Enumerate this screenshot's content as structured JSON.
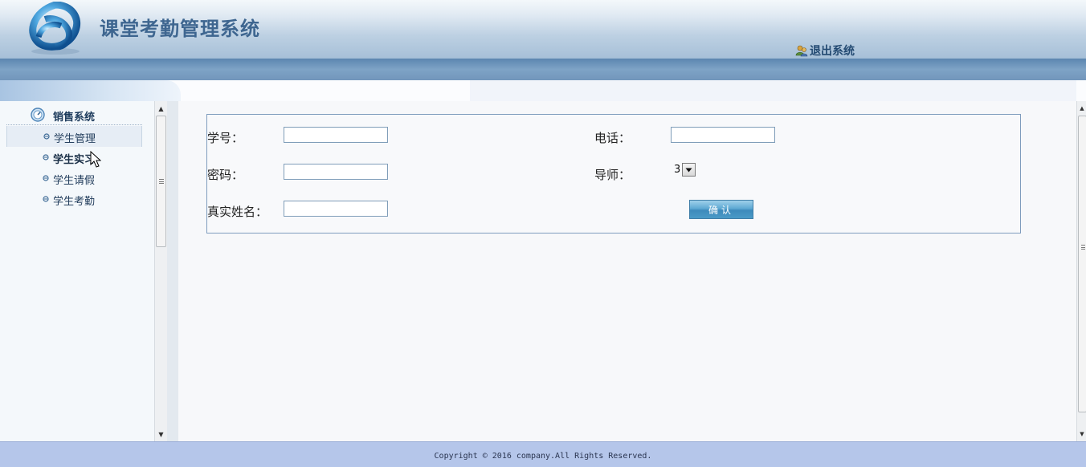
{
  "header": {
    "title": "课堂考勤管理系统",
    "logout_label": "退出系统"
  },
  "sidebar": {
    "group_label": "销售系统",
    "items": [
      {
        "label": "学生管理",
        "active": true
      },
      {
        "label": "学生实习",
        "hovered": true
      },
      {
        "label": "学生请假"
      },
      {
        "label": "学生考勤"
      }
    ]
  },
  "form": {
    "student_id_label": "学号：",
    "student_id_value": "",
    "password_label": "密码：",
    "password_value": "",
    "real_name_label": "真实姓名：",
    "real_name_value": "",
    "phone_label": "电话：",
    "phone_value": "",
    "tutor_label": "导师：",
    "tutor_selected": "3",
    "confirm_label": "确认"
  },
  "footer": {
    "copyright": "Copyright © 2016 company.All Rights Reserved."
  },
  "colors": {
    "accent": "#3e6690",
    "footer_bg": "#b5c6ea",
    "form_border": "#7e9cbd"
  }
}
